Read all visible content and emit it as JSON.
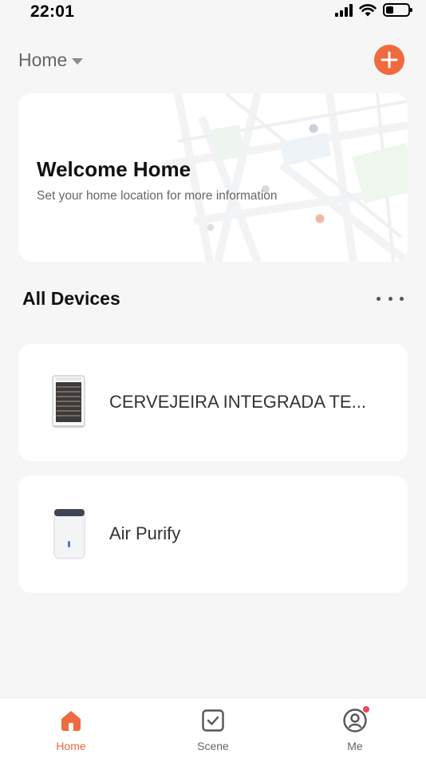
{
  "status_bar": {
    "time": "22:01",
    "icons": [
      "signal-icon",
      "wifi-icon",
      "battery-icon"
    ]
  },
  "header": {
    "home_label": "Home",
    "add_icon": "plus-icon",
    "accent_color": "#ef6a3f"
  },
  "welcome": {
    "title": "Welcome Home",
    "subtitle": "Set your home location for more information"
  },
  "devices_section": {
    "title": "All Devices",
    "more_icon": "more-icon"
  },
  "devices": [
    {
      "name": "CERVEJEIRA INTEGRADA TE...",
      "icon": "wine-cooler-icon"
    },
    {
      "name": "Air Purify",
      "icon": "air-purifier-icon"
    }
  ],
  "tabs": [
    {
      "label": "Home",
      "icon": "home-icon",
      "active": true
    },
    {
      "label": "Scene",
      "icon": "scene-checkbox-icon",
      "active": false
    },
    {
      "label": "Me",
      "icon": "profile-icon",
      "active": false,
      "badge": true
    }
  ]
}
